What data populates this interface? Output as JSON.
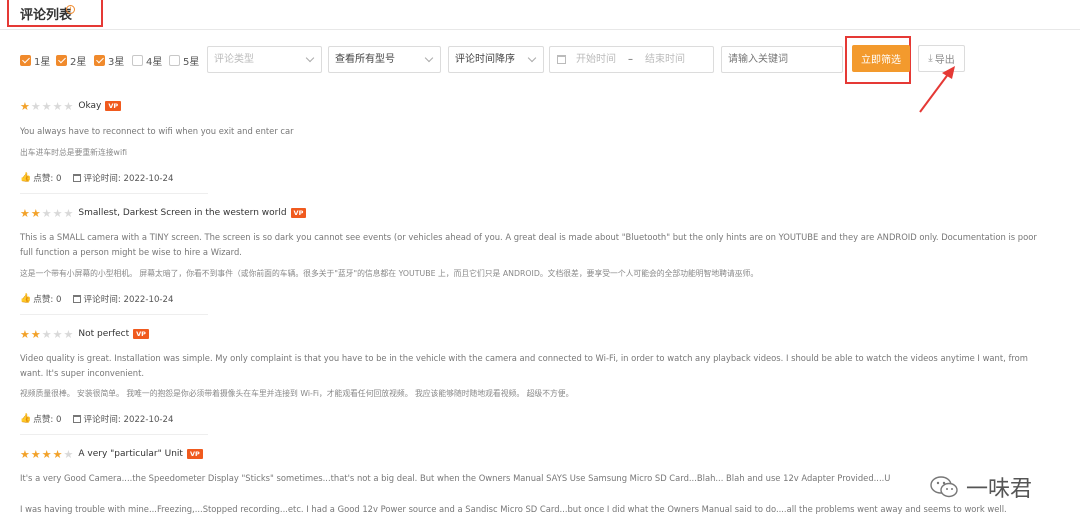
{
  "header": {
    "title": "评论列表",
    "info_icon": "info-circle-icon"
  },
  "filters": {
    "stars": [
      {
        "label": "1星",
        "checked": true
      },
      {
        "label": "2星",
        "checked": true
      },
      {
        "label": "3星",
        "checked": true
      },
      {
        "label": "4星",
        "checked": false
      },
      {
        "label": "5星",
        "checked": false
      }
    ],
    "comment_type_placeholder": "评论类型",
    "model_select": "查看所有型号",
    "sort_select": "评论时间降序",
    "date_start_placeholder": "开始时间",
    "date_separator": "–",
    "date_end_placeholder": "结束时间",
    "keyword_placeholder": "请输入关键词",
    "filter_button": "立即筛选",
    "export_button": "导出"
  },
  "colors": {
    "accent": "#f39a2d",
    "annotation": "#e53935",
    "vp_badge": "#f05a1e"
  },
  "reviews": [
    {
      "rating": 1,
      "title": "Okay",
      "badge": "VP",
      "text_en": "You always have to reconnect to wifi when you exit and enter car",
      "text_en2": "",
      "text_zh": "出车进车时总是要重新连接wifi",
      "likes": "点赞: 0",
      "time": "评论时间: 2022-10-24"
    },
    {
      "rating": 2,
      "title": "Smallest, Darkest Screen in the western world",
      "badge": "VP",
      "text_en": "This is a SMALL camera with a TINY screen. The screen is so dark you cannot see events (or vehicles ahead of you. A great deal is made about \"Bluetooth\" but the only hints are on YOUTUBE and they are ANDROID only. Documentation is poor",
      "text_en2": "full function a person might be wise to hire a Wizard.",
      "text_zh": "这是一个带有小屏幕的小型相机。 屏幕太暗了，你看不到事件（或你前面的车辆。很多关于\"蓝牙\"的信息都在 YOUTUBE 上，而且它们只是 ANDROID。文档很差，要享受一个人可能会的全部功能明智地聘请巫师。",
      "likes": "点赞: 0",
      "time": "评论时间: 2022-10-24"
    },
    {
      "rating": 2,
      "title": "Not perfect",
      "badge": "VP",
      "text_en": "Video quality is great. Installation was simple. My only complaint is that you have to be in the vehicle with the camera and connected to Wi-Fi, in order to watch any playback videos. I should be able to watch the videos anytime I want, from",
      "text_en2": "want. It's super inconvenient.",
      "text_zh": "视频质量很棒。 安装很简单。 我唯一的抱怨是你必须带着摄像头在车里并连接到 Wi-Fi，才能观看任何回放视频。 我应该能够随时随地观看视频。 超级不方便。",
      "likes": "点赞: 0",
      "time": "评论时间: 2022-10-24"
    },
    {
      "rating": 4,
      "title": "A very \"particular\" Unit",
      "badge": "VP",
      "text_en": "It's a very Good Camera....the Speedometer Display \"Sticks\" sometimes...that's not a big deal. But when the Owners Manual SAYS Use Samsung Micro SD Card...Blah... Blah and use 12v Adapter Provided....U",
      "text_en2": "I was having trouble with mine...Freezing,...Stopped recording...etc. I had a Good 12v Power source and a Sandisc Micro SD Card...but once I did what the Owners Manual said to do....all the problems went away and seems to work well.",
      "text_zh": "",
      "likes": "",
      "time": ""
    }
  ],
  "watermark": {
    "text": "一味君",
    "icon": "wechat-icon"
  }
}
